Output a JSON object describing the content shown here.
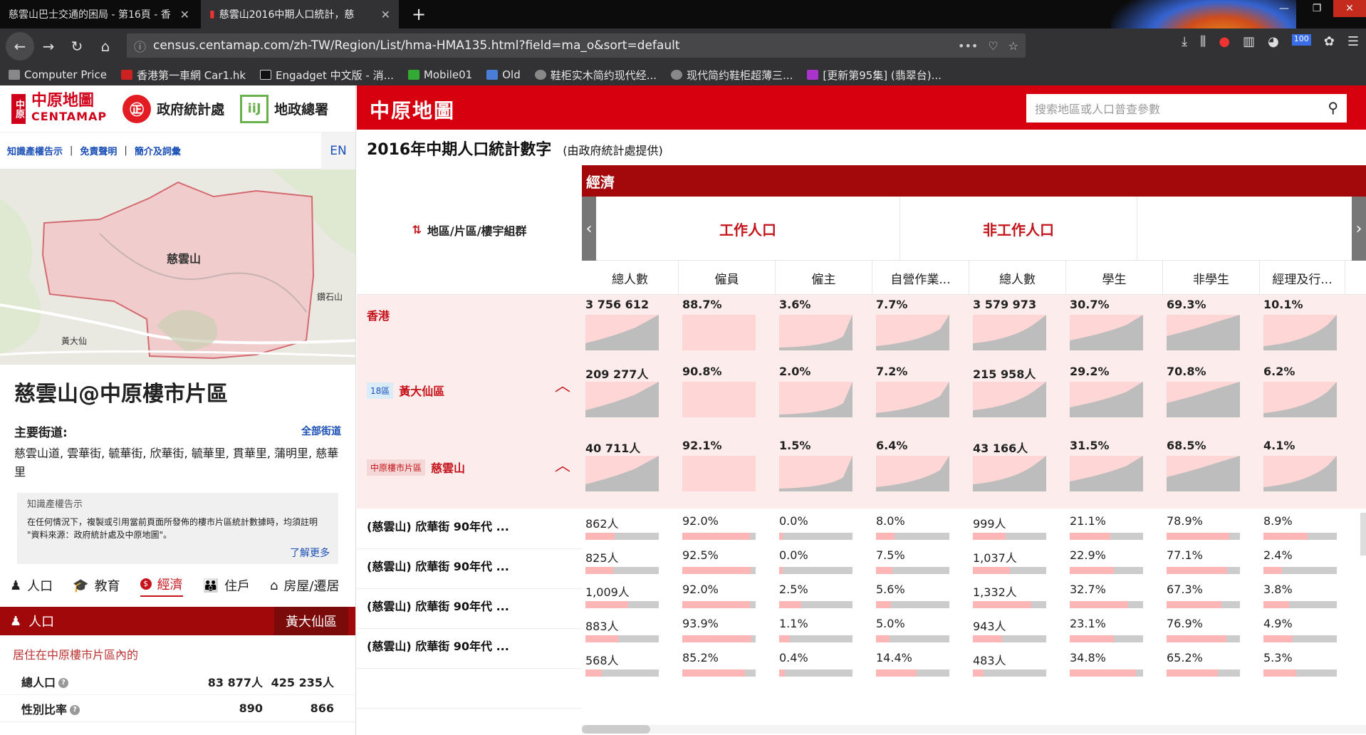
{
  "browser": {
    "tabs": [
      {
        "title": "慈雲山巴士交通的困局 - 第16頁 - 香"
      },
      {
        "title": "慈雲山2016中期人口統計，慈"
      }
    ],
    "url_path": "census.centamap.com/zh-TW/Region/List/hma-HMA135.html?field=ma_o&sort=default",
    "badge_count": "100",
    "bookmarks": [
      {
        "label": "Computer Price"
      },
      {
        "label": "香港第一車網 Car1.hk"
      },
      {
        "label": "Engadget 中文版 - 消..."
      },
      {
        "label": "Mobile01"
      },
      {
        "label": "Old"
      },
      {
        "label": "鞋柜实木简约现代经..."
      },
      {
        "label": "现代简约鞋柜超薄三..."
      },
      {
        "label": "[更新第95集] (翡翠台)..."
      }
    ]
  },
  "left": {
    "logo_centamap_cn": "中原地圖",
    "logo_centamap_en": "CENTAMAP",
    "logo_gov": "政府統計處",
    "logo_land": "地政總署",
    "links": [
      "知識產權告示",
      "免責聲明",
      "簡介及詞彙"
    ],
    "en": "EN",
    "map_labels": {
      "main": "慈雲山",
      "east": "鑽石山",
      "west": "黃大仙"
    },
    "title": "慈雲山@中原樓市片區",
    "streets_heading": "主要街道:",
    "all_streets": "全部街道",
    "streets": "慈雲山道, 雲華街, 毓華街, 欣華街, 毓華里, 貫華里, 蒲明里, 慈華里",
    "notice_heading": "知識產權告示",
    "notice_text": "在任何情況下，複製或引用當前頁面所發佈的樓市片區統計數據時，均須註明 \"資料來源：政府統計處及中原地圖\"。",
    "notice_more": "了解更多",
    "categories": [
      "人口",
      "教育",
      "經濟",
      "住戶",
      "房屋/遷居"
    ],
    "active_category": "經濟",
    "pop_bar_label": "人口",
    "pop_bar_region": "黃大仙區",
    "pop_heading": "居住在中原樓市片區內的",
    "pop_rows": [
      {
        "label": "總人口",
        "v1": "83 877人",
        "v2": "425 235人"
      },
      {
        "label": "性別比率",
        "v1": "890",
        "v2": "866"
      }
    ]
  },
  "main": {
    "brand": "中原地圖",
    "search_placeholder": "搜索地區或人口普查參數",
    "stat_title": "2016年中期人口統計數字",
    "stat_sub": "(由政府統計處提供)",
    "col_region": "地區/片區/樓宇組群",
    "section": "經濟",
    "groups": [
      "工作人口",
      "非工作人口"
    ],
    "subcols": [
      "總人數",
      "僱員",
      "僱主",
      "自營作業...",
      "總人數",
      "學生",
      "非學生",
      "經理及行..."
    ],
    "summary_rows": [
      {
        "name": "香港",
        "badge": "",
        "values": [
          "3 756 612人",
          "88.7%",
          "3.6%",
          "7.7%",
          "3 579 973人",
          "30.7%",
          "69.3%",
          "10.1%"
        ]
      },
      {
        "name": "黃大仙區",
        "badge": "18區",
        "values": [
          "209 277人",
          "90.8%",
          "2.0%",
          "7.2%",
          "215 958人",
          "29.2%",
          "70.8%",
          "6.2%"
        ]
      },
      {
        "name": "慈雲山",
        "badge": "中原樓市片區",
        "values": [
          "40 711人",
          "92.1%",
          "1.5%",
          "6.4%",
          "43 166人",
          "31.5%",
          "68.5%",
          "4.1%"
        ]
      }
    ],
    "detail_rows": [
      {
        "name": "(慈雲山) 欣華街 90年代 ...",
        "values": [
          "862人",
          "92.0%",
          "0.0%",
          "8.0%",
          "999人",
          "21.1%",
          "78.9%",
          "8.9%"
        ]
      },
      {
        "name": "(慈雲山) 欣華街 90年代 ...",
        "values": [
          "825人",
          "92.5%",
          "0.0%",
          "7.5%",
          "1,037人",
          "22.9%",
          "77.1%",
          "2.4%"
        ]
      },
      {
        "name": "(慈雲山) 欣華街 90年代 ...",
        "values": [
          "1,009人",
          "92.0%",
          "2.5%",
          "5.6%",
          "1,332人",
          "32.7%",
          "67.3%",
          "3.8%"
        ]
      },
      {
        "name": "(慈雲山) 欣華街 90年代 ...",
        "values": [
          "883人",
          "93.9%",
          "1.1%",
          "5.0%",
          "943人",
          "23.1%",
          "76.9%",
          "4.9%"
        ]
      },
      {
        "name": "",
        "values": [
          "568人",
          "85.2%",
          "0.4%",
          "14.4%",
          "483人",
          "34.8%",
          "65.2%",
          "5.3%"
        ]
      }
    ],
    "detail_bar_fill": [
      [
        0.4,
        0.92,
        0.05,
        0.25,
        0.45,
        0.55,
        0.85,
        0.6
      ],
      [
        0.38,
        0.93,
        0.05,
        0.22,
        0.5,
        0.6,
        0.83,
        0.25
      ],
      [
        0.58,
        0.92,
        0.3,
        0.2,
        0.8,
        0.8,
        0.75,
        0.35
      ],
      [
        0.45,
        0.94,
        0.15,
        0.18,
        0.4,
        0.6,
        0.82,
        0.4
      ],
      [
        0.22,
        0.85,
        0.08,
        0.55,
        0.15,
        0.9,
        0.7,
        0.45
      ]
    ]
  }
}
